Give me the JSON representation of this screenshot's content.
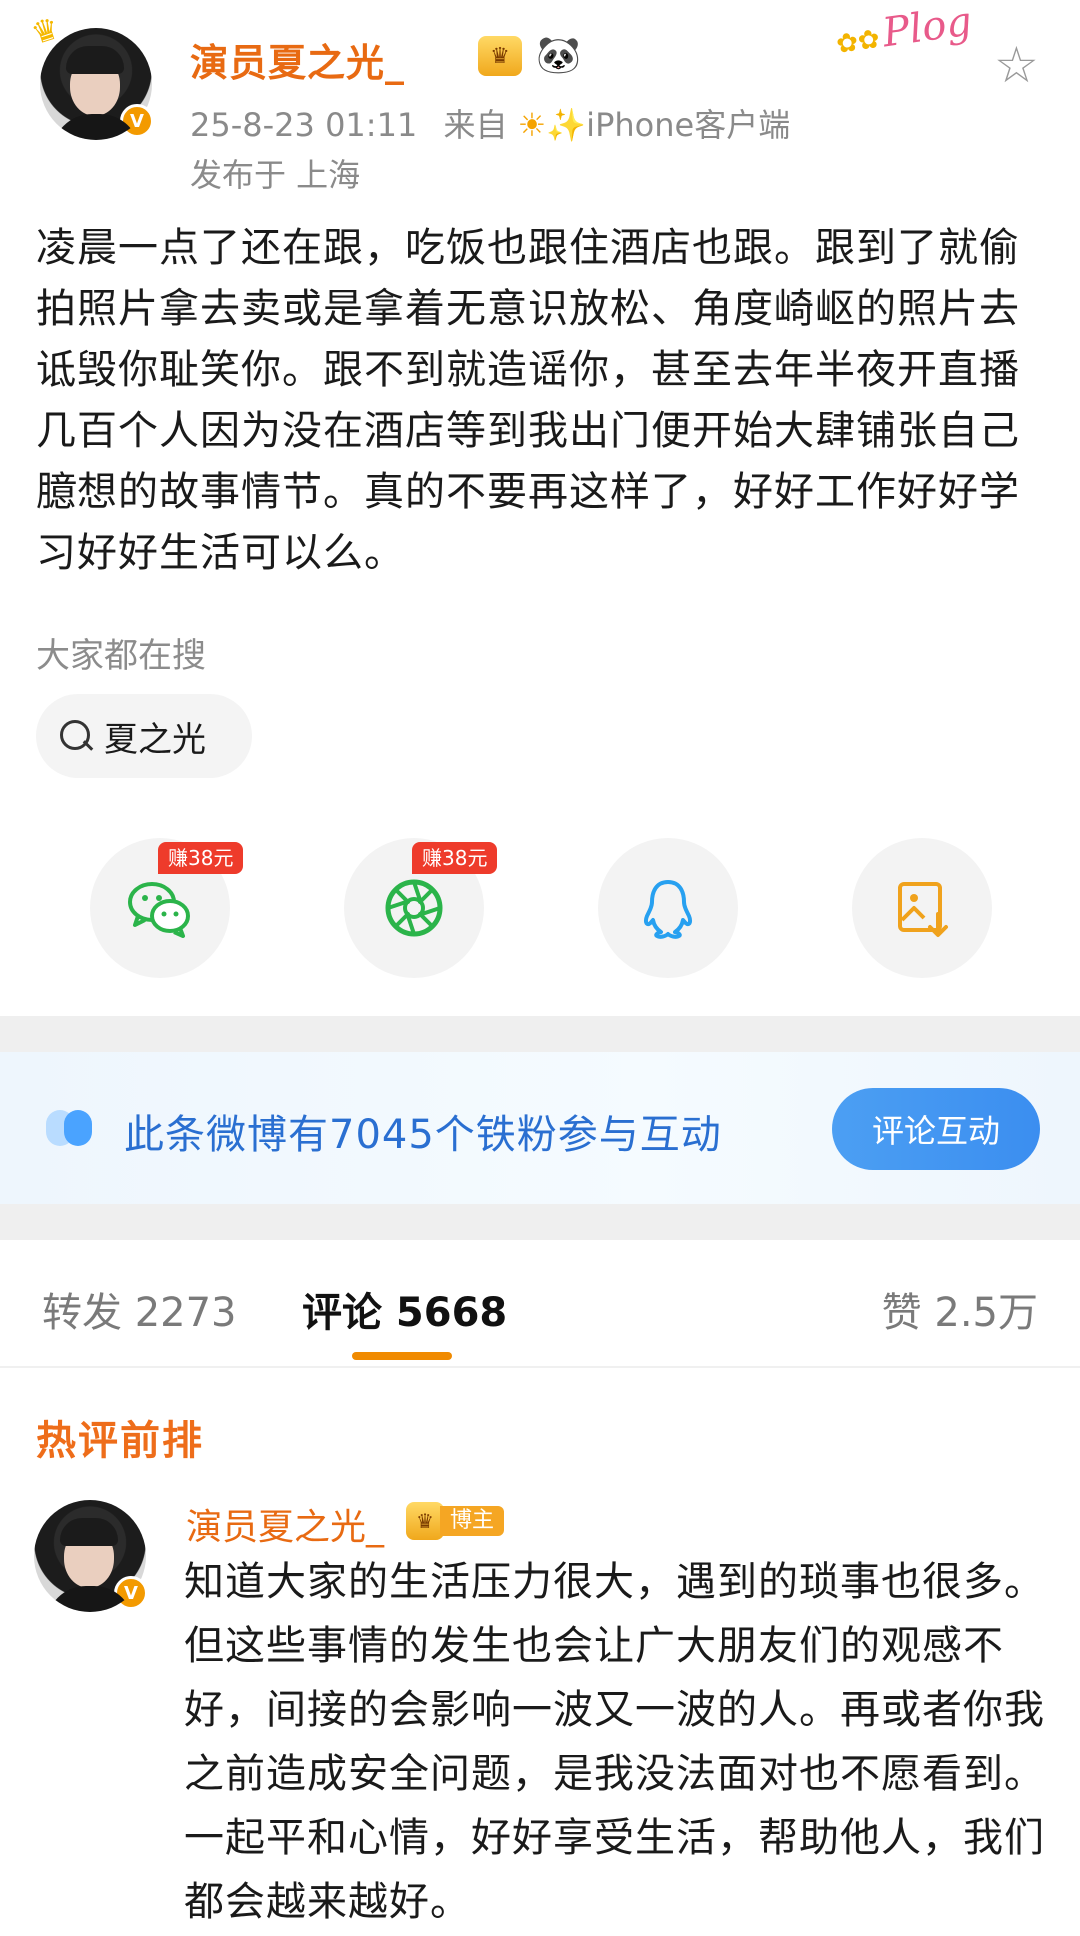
{
  "post": {
    "author": "演员夏之光_",
    "timestamp": "25-8-23 01:11",
    "source_prefix": "来自",
    "source_client": "iPhone客户端",
    "location": "发布于 上海",
    "sticker_text": "Plog",
    "content": "凌晨一点了还在跟，吃饭也跟住酒店也跟。跟到了就偷拍照片拿去卖或是拿着无意识放松、角度崎岖的照片去诋毁你耻笑你。跟不到就造谣你，甚至去年半夜开直播几百个人因为没在酒店等到我出门便开始大肆铺张自己臆想的故事情节。真的不要再这样了，好好工作好好学习好好生活可以么。"
  },
  "search": {
    "label": "大家都在搜",
    "chip": "夏之光"
  },
  "share": {
    "items": [
      {
        "name": "wechat",
        "reward": "赚38元",
        "color": "#2bb44a"
      },
      {
        "name": "moments",
        "reward": "赚38元",
        "color": "#2bb44a"
      },
      {
        "name": "qq",
        "reward": "",
        "color": "#27a0f0"
      },
      {
        "name": "save-image",
        "reward": "",
        "color": "#f0a21c"
      }
    ]
  },
  "fan_banner": {
    "text": "此条微博有7045个铁粉参与互动",
    "button": "评论互动"
  },
  "tabs": {
    "repost": "转发 2273",
    "comment": "评论 5668",
    "like": "赞 2.5万",
    "active": "comment",
    "accent": "#f08a00"
  },
  "hot_comments": {
    "title": "热评前排",
    "items": [
      {
        "author": "演员夏之光_",
        "badge": "博主",
        "text": "知道大家的生活压力很大，遇到的琐事也很多。但这些事情的发生也会让广大朋友们的观感不好，间接的会影响一波又一波的人。再或者你我之前造成安全问题，是我没法面对也不愿看到。一起平和心情，好好享受生活，帮助他人，我们都会越来越好。"
      }
    ]
  },
  "icons": {
    "favorite": "star-icon",
    "verified": "verified-v-icon",
    "search": "search-icon"
  },
  "colors": {
    "username": "#e86a12",
    "link_blue": "#2a6fd1",
    "hot_title": "#ee6d1a"
  }
}
